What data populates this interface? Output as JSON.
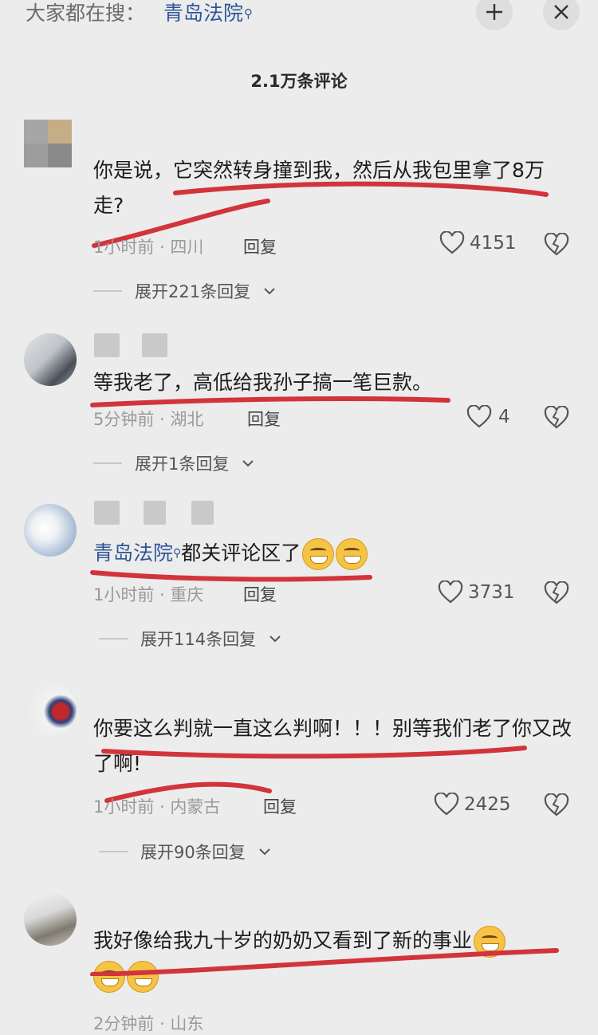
{
  "search": {
    "prefix": "大家都在搜：",
    "term": "青岛法院"
  },
  "comment_count_title": "2.1万条评论",
  "actions": {
    "reply_label": "回复"
  },
  "comments": [
    {
      "text": "你是说，它突然转身撞到我，然后从我包里拿了8万走?",
      "time": "1小时前",
      "location": "四川",
      "likes": "4151",
      "expand": "展开221条回复"
    },
    {
      "text": "等我老了，高低给我孙子搞一笔巨款。",
      "time": "5分钟前",
      "location": "湖北",
      "likes": "4",
      "expand": "展开1条回复"
    },
    {
      "link": "青岛法院",
      "text": "都关评论区了",
      "time": "1小时前",
      "location": "重庆",
      "likes": "3731",
      "expand": "展开114条回复"
    },
    {
      "text": "你要这么判就一直这么判啊！！！别等我们老了你又改了啊!",
      "time": "1小时前",
      "location": "内蒙古",
      "likes": "2425",
      "expand": "展开90条回复"
    },
    {
      "text": "我好像给我九十岁的奶奶又看到了新的事业",
      "time": "2分钟前",
      "location": "山东"
    }
  ],
  "colors": {
    "accent_link": "#2f5597",
    "annotation_red": "#d2343c",
    "background": "#ececec"
  },
  "icons": [
    "search-magnifier-icon",
    "add-icon",
    "close-icon",
    "heart-icon",
    "broken-heart-icon",
    "chevron-down-icon",
    "grin-sweat-emoji-icon"
  ]
}
